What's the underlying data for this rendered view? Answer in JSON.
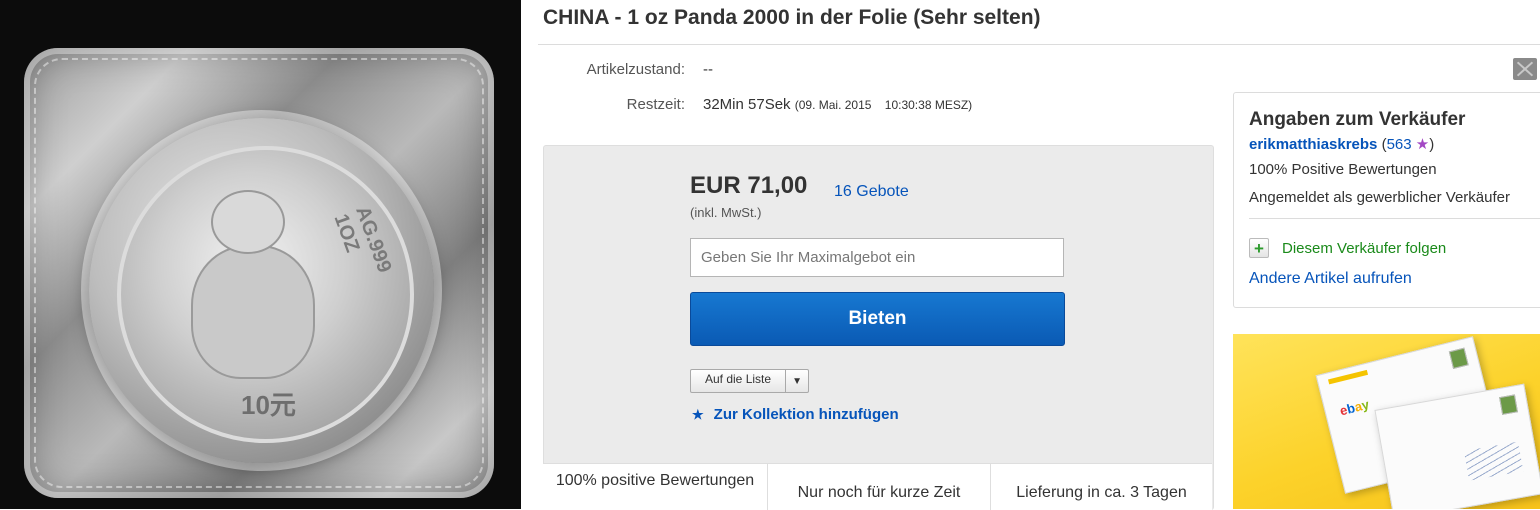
{
  "product": {
    "title": "CHINA - 1 oz Panda 2000 in der Folie (Sehr selten)",
    "coin_value_text": "10元",
    "coin_rim_text": "AG.999 1OZ"
  },
  "details": {
    "condition_label": "Artikelzustand:",
    "condition_value": "--",
    "time_label": "Restzeit:",
    "time_value": "32Min 57Sek",
    "time_end": "(09. Mai. 2015    10:30:38 MESZ)"
  },
  "bid": {
    "price": "EUR 71,00",
    "bid_count": "16 Gebote",
    "vat_note": "(inkl. MwSt.)",
    "input_placeholder": "Geben Sie Ihr Maximalgebot ein",
    "button_label": "Bieten",
    "watchlist_label": "Auf die Liste",
    "collection_label": "Zur Kollektion hinzufügen"
  },
  "features": [
    "100% positive Bewertungen",
    "Nur noch für kurze Zeit",
    "Lieferung in ca. 3 Tagen"
  ],
  "seller": {
    "heading": "Angaben zum Verkäufer",
    "name": "erikmatthiaskrebs",
    "score": "563",
    "positive": "100% Positive Bewertungen",
    "type": "Angemeldet als gewerblicher Verkäufer",
    "follow_label": "Diesem Verkäufer folgen",
    "other_items": "Andere Artikel aufrufen"
  },
  "ad": {
    "logo_letters": [
      "e",
      "b",
      "a",
      "y"
    ]
  },
  "colors": {
    "link": "#0654ba",
    "button": "#0a5ab4",
    "follow_green": "#1a8a1a",
    "star": "#a348c4",
    "ad_yellow": "#fcd22a"
  },
  "icons": {
    "mail": "mail-icon",
    "collection": "star-icon",
    "seller_star": "star-icon",
    "follow": "plus-icon",
    "dropdown": "chevron-down-icon"
  }
}
